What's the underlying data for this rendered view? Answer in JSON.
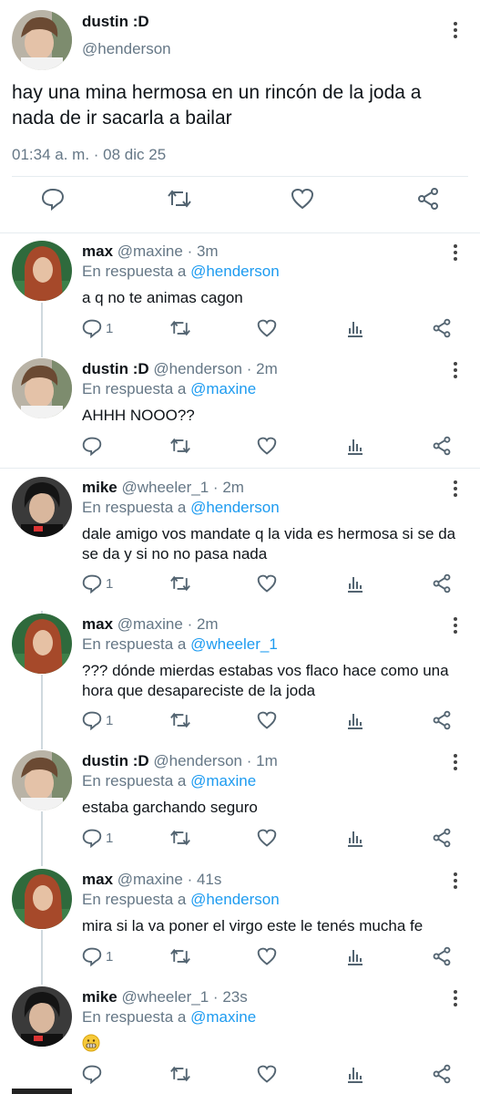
{
  "main_tweet": {
    "name": "dustin :D",
    "handle": "@henderson",
    "text": "hay una mina hermosa en un rincón de la joda a nada de ir sacarla a bailar",
    "timestamp": "01:34 a. m. · 08 dic 25",
    "actions": [
      "comment-icon",
      "retweet-icon",
      "like-icon",
      "share-icon"
    ]
  },
  "replies": [
    {
      "name": "max",
      "handle": "@maxine",
      "time": "3m",
      "reply_prefix": "En respuesta a",
      "reply_to": "@henderson",
      "text": "a q no te animas cagon",
      "reply_count": "1"
    },
    {
      "name": "dustin :D",
      "handle": "@henderson",
      "time": "2m",
      "reply_prefix": "En respuesta a",
      "reply_to": "@maxine",
      "text": "AHHH NOOO??",
      "reply_count": ""
    },
    {
      "name": "mike",
      "handle": "@wheeler_1",
      "time": "2m",
      "reply_prefix": "En respuesta a",
      "reply_to": "@henderson",
      "text": "dale amigo vos mandate q la vida es hermosa si se da se da y si no no pasa nada",
      "reply_count": "1"
    },
    {
      "name": "max",
      "handle": "@maxine",
      "time": "2m",
      "reply_prefix": "En respuesta a",
      "reply_to": "@wheeler_1",
      "text": "??? dónde mierdas estabas vos flaco hace como una hora que desapareciste de la joda",
      "reply_count": "1"
    },
    {
      "name": "dustin :D",
      "handle": "@henderson",
      "time": "1m",
      "reply_prefix": "En respuesta a",
      "reply_to": "@maxine",
      "text": "estaba garchando seguro",
      "reply_count": "1"
    },
    {
      "name": "max",
      "handle": "@maxine",
      "time": "41s",
      "reply_prefix": "En respuesta a",
      "reply_to": "@henderson",
      "text": "mira si la va poner el virgo este le tenés mucha fe",
      "reply_count": "1"
    },
    {
      "name": "mike",
      "handle": "@wheeler_1",
      "time": "23s",
      "reply_prefix": "En respuesta a",
      "reply_to": "@maxine",
      "text": "",
      "emoji": "grimacing-emoji",
      "reply_count": ""
    }
  ],
  "colors": {
    "link": "#1d9bf0",
    "muted": "#657786",
    "text": "#0f1419",
    "divider": "#e6ecf0"
  }
}
